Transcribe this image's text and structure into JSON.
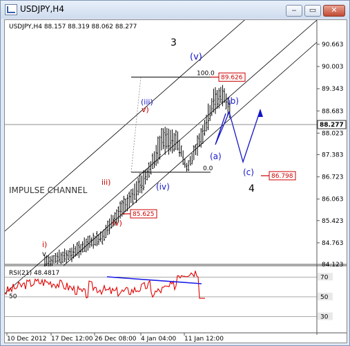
{
  "window": {
    "title": "USDJPY,H4",
    "buttons": {
      "minimize": "‒",
      "maximize": "▭",
      "close": "✕"
    }
  },
  "chart_data": {
    "type": "candlestick",
    "symbol_line": "USDJPY,H4  88.157 88.319 88.062 88.277",
    "price_axis_ticks": [
      90.663,
      90.003,
      89.343,
      88.683,
      88.023,
      87.383,
      86.723,
      86.063,
      85.423,
      84.763,
      84.123
    ],
    "ylim": [
      83.95,
      91.05
    ],
    "current_price": "88.277",
    "time_axis_labels": [
      "10 Dec 2012",
      "17 Dec 12:00",
      "26 Dec 08:00",
      "4 Jan 04:00",
      "11 Jan 12:00"
    ],
    "price_series_approx": [
      {
        "t": 0.1,
        "low": 83.9,
        "high": 84.4
      },
      {
        "t": 0.2,
        "low": 84.0,
        "high": 84.7
      },
      {
        "t": 0.32,
        "low": 84.6,
        "high": 85.3
      },
      {
        "t": 0.38,
        "low": 85.3,
        "high": 86.1
      },
      {
        "t": 0.44,
        "low": 85.9,
        "high": 86.9
      },
      {
        "t": 0.48,
        "low": 86.6,
        "high": 87.4
      },
      {
        "t": 0.52,
        "low": 87.2,
        "high": 88.5
      },
      {
        "t": 0.57,
        "low": 87.3,
        "high": 88.2
      },
      {
        "t": 0.6,
        "low": 86.72,
        "high": 87.2
      },
      {
        "t": 0.66,
        "low": 87.6,
        "high": 88.8
      },
      {
        "t": 0.69,
        "low": 88.4,
        "high": 89.6
      },
      {
        "t": 0.72,
        "low": 88.7,
        "high": 89.63
      },
      {
        "t": 0.75,
        "low": 88.06,
        "high": 89.0
      }
    ],
    "levels": [
      {
        "label": "100.0",
        "value": 89.626,
        "box": "89.626"
      },
      {
        "label": "0.0",
        "value": 86.798,
        "box": "86.798"
      },
      {
        "box": "85.625",
        "value": 85.625
      }
    ],
    "wave_labels": [
      "3",
      "(v)",
      "(iii)",
      "v)",
      "iii)",
      "iv)",
      "(iv)",
      "i)",
      "v",
      "(a)",
      "(b)",
      "(c)",
      "4"
    ],
    "annotation": "IMPULSE CHANNEL",
    "rsi": {
      "label": "RSI(21) 48.4817",
      "levels": [
        70,
        50,
        30
      ],
      "current": 48.48,
      "left_label": "50"
    },
    "colors": {
      "candles": "#000000",
      "channel": "#000000",
      "wave_blue": "#1515c8",
      "wave_red": "#cc0000",
      "box_red": "#cc0000",
      "rsi_line": "#e00000",
      "divergence": "#1a1ae6"
    }
  }
}
